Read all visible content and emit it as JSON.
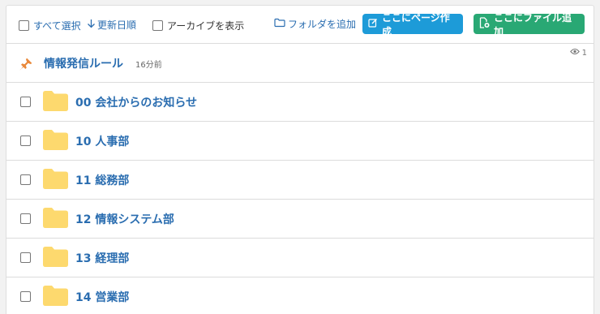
{
  "toolbar": {
    "select_all_label": "すべて選択",
    "sort_label": "更新日順",
    "archive_label": "アーカイブを表示",
    "add_folder_label": "フォルダを追加",
    "create_page_label": "ここにページ作成",
    "add_file_label": "ここにファイル追加"
  },
  "pinned": {
    "title": "情報発信ルール",
    "time": "16分前",
    "view_count": "1"
  },
  "folders": [
    {
      "name": "00 会社からのお知らせ"
    },
    {
      "name": "10 人事部"
    },
    {
      "name": "11 総務部"
    },
    {
      "name": "12 情報システム部"
    },
    {
      "name": "13 経理部"
    },
    {
      "name": "14 営業部"
    }
  ],
  "colors": {
    "link": "#2a6db0",
    "create_page_button": "#1d9bd8",
    "add_file_button": "#29a874",
    "folder": "#fdd96e",
    "pin": "#e9883a"
  },
  "icons": {
    "sort": "arrow-down-icon",
    "add_folder": "folder-outline-icon",
    "create_page": "edit-icon",
    "add_file": "file-add-icon",
    "pin": "pin-icon",
    "views": "eye-icon",
    "folder": "folder-icon"
  }
}
